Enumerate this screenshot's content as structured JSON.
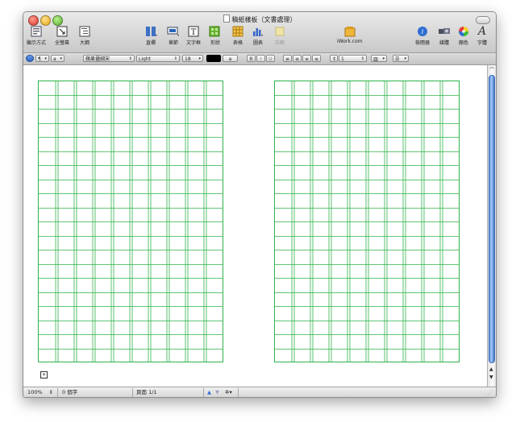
{
  "window": {
    "title": "稿紙樣板（文書處理）"
  },
  "toolbar": {
    "view_mode": "顯示方式",
    "fullscreen": "全螢幕",
    "outline": "大綱",
    "columns": "直欄",
    "sections": "章節",
    "textbox": "文字框",
    "shapes": "形狀",
    "table": "表格",
    "chart": "圖表",
    "comment": "註解",
    "iwork": "iWork.com",
    "inspector": "檢閱器",
    "media": "媒體",
    "colors": "顏色",
    "fonts": "字體"
  },
  "formatbar": {
    "paragraph_style": "¶",
    "list_style": "a",
    "font_family": "蘋果儷細宋",
    "font_typeface": "Light",
    "font_size": "18",
    "text_color_label": "a",
    "bold": "B",
    "italic": "I",
    "underline": "U",
    "line_spacing": "1",
    "columns_value": "",
    "list_value": ""
  },
  "status": {
    "zoom": "100%",
    "word_count": "0 個字",
    "page_indicator": "頁面 1/1"
  },
  "colors": {
    "grid_green": "#2eb34a",
    "scroll_blue": "#4a80d4"
  },
  "grid": {
    "columns": 10,
    "rows": 20
  }
}
